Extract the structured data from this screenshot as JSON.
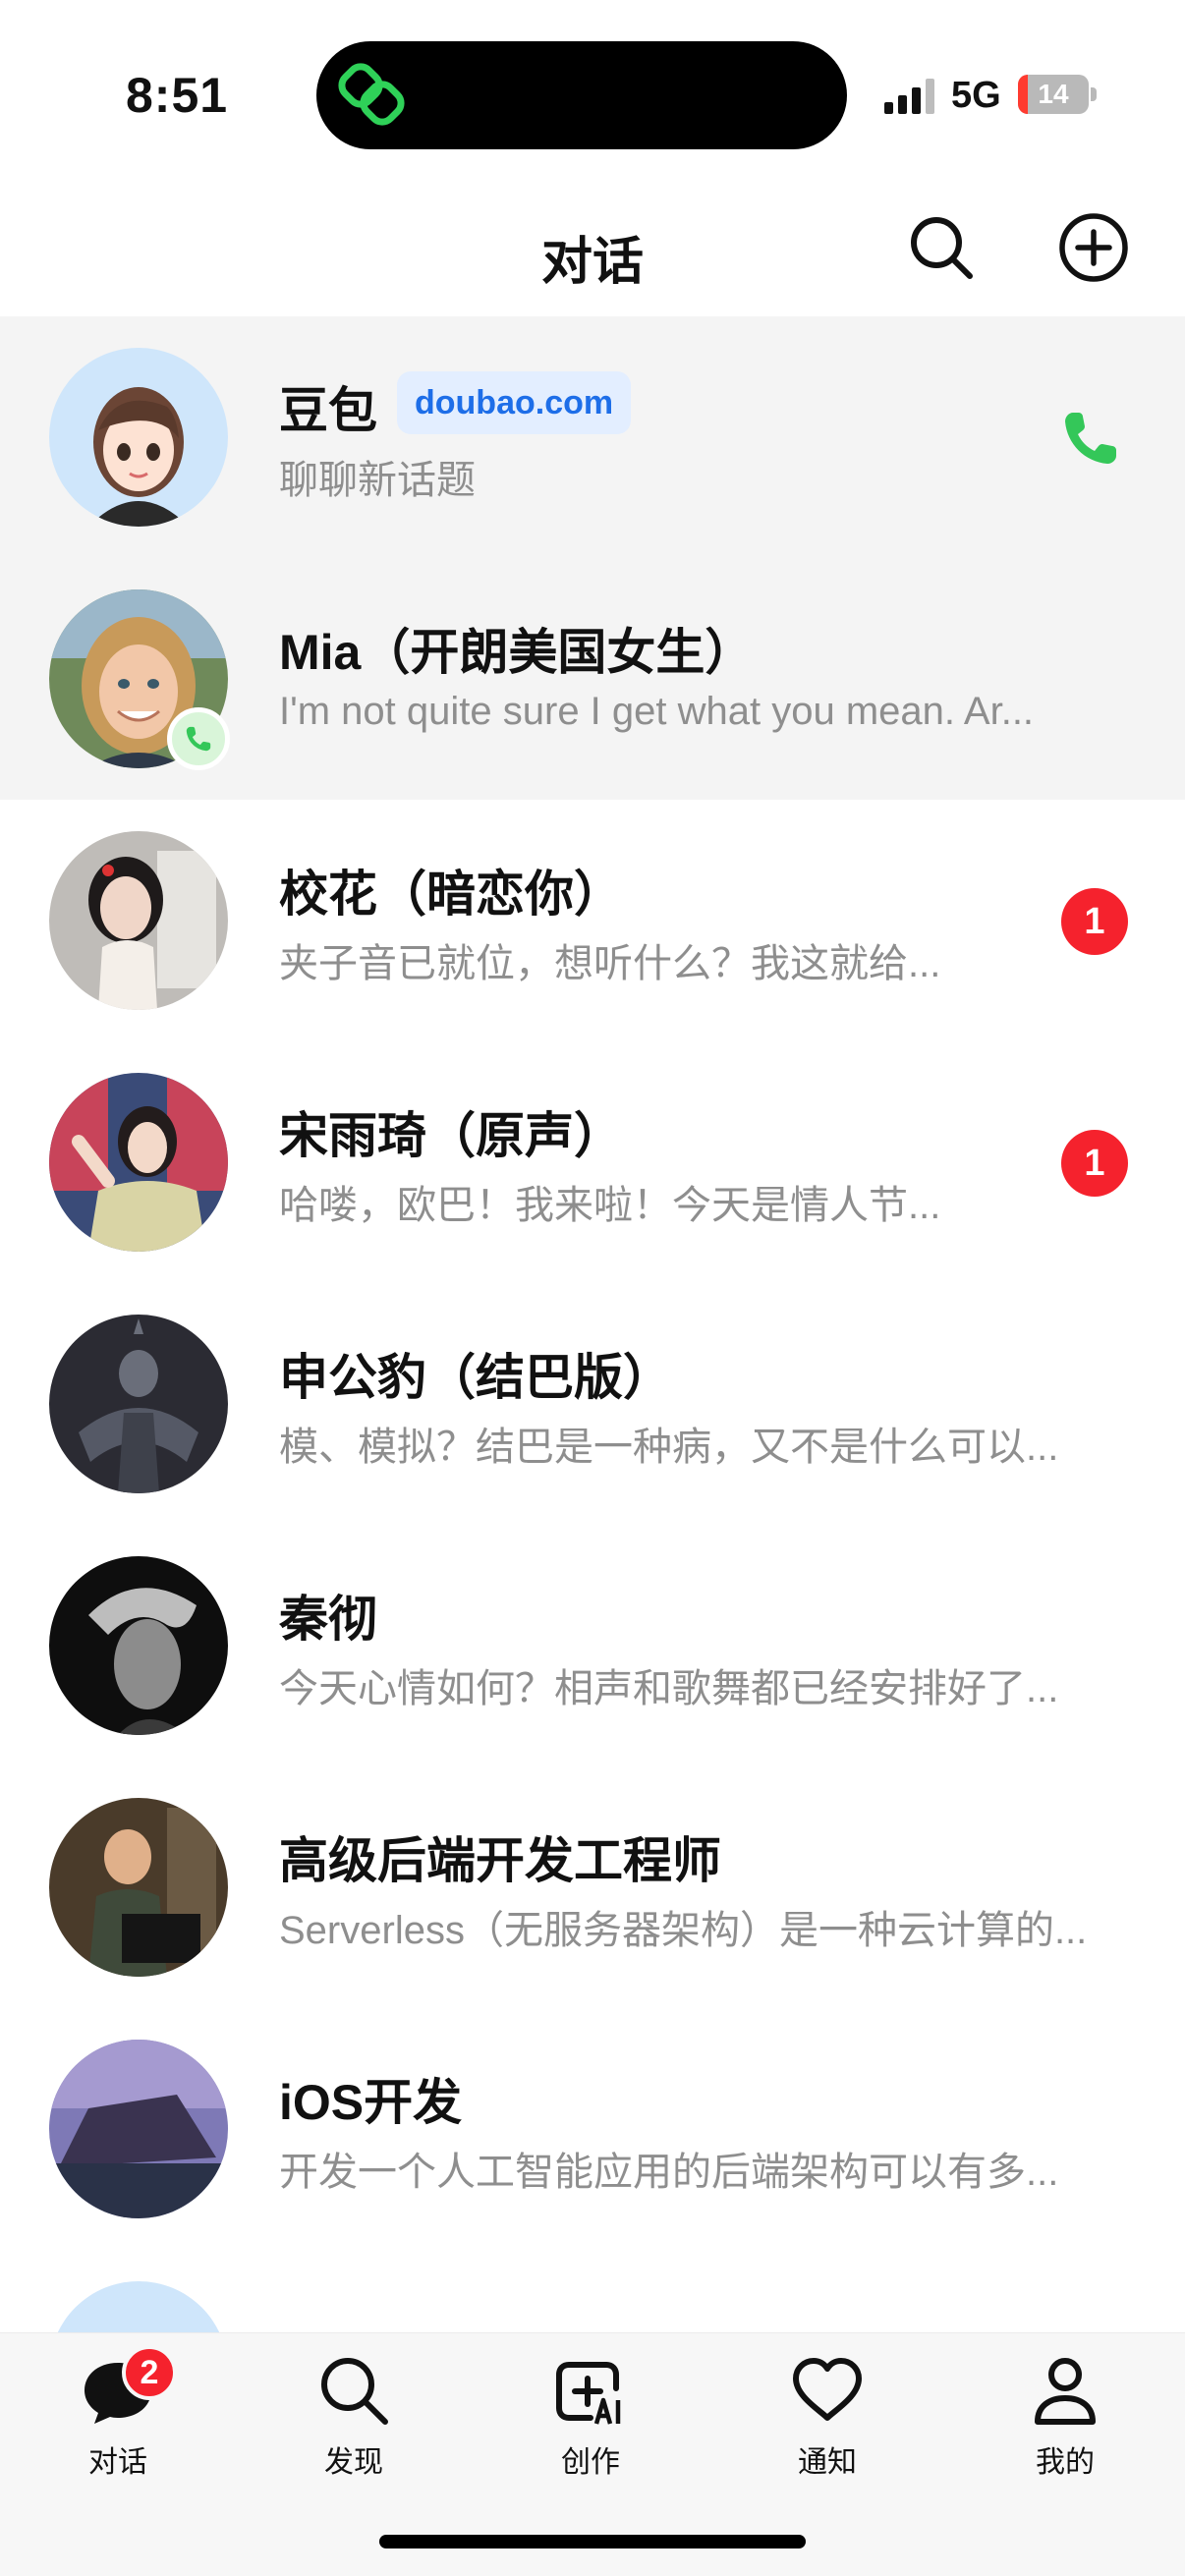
{
  "status_bar": {
    "time": "8:51",
    "network": "5G",
    "battery": "14",
    "battery_level": 0.14
  },
  "header": {
    "title": "对话"
  },
  "conversations": [
    {
      "name": "豆包",
      "tag": "doubao.com",
      "preview": "聊聊新话题",
      "pinned": true,
      "action_icon": "phone-icon"
    },
    {
      "name": "Mia（开朗美国女生）",
      "preview": "I'm not quite sure I get what you mean. Ar...",
      "pinned": true,
      "avatar_badge": "phone-icon"
    },
    {
      "name": "校花（暗恋你）",
      "preview": "夹子音已就位，想听什么？我这就给...",
      "unread": "1"
    },
    {
      "name": "宋雨琦（原声）",
      "preview": "哈喽，欧巴！我来啦！今天是情人节...",
      "unread": "1"
    },
    {
      "name": "申公豹（结巴版）",
      "preview": "模、模拟？结巴是一种病，又不是什么可以..."
    },
    {
      "name": "秦彻",
      "preview": "今天心情如何？相声和歌舞都已经安排好了..."
    },
    {
      "name": "高级后端开发工程师",
      "preview": "Serverless（无服务器架构）是一种云计算的..."
    },
    {
      "name": "iOS开发",
      "preview": "开发一个人工智能应用的后端架构可以有多..."
    },
    {
      "name": "",
      "preview": ""
    }
  ],
  "tabbar": {
    "tabs": [
      {
        "label": "对话",
        "icon": "chat-bubble-icon",
        "badge": "2",
        "active": true
      },
      {
        "label": "发现",
        "icon": "search-icon"
      },
      {
        "label": "创作",
        "icon": "create-ai-icon"
      },
      {
        "label": "通知",
        "icon": "heart-icon"
      },
      {
        "label": "我的",
        "icon": "person-icon"
      }
    ]
  },
  "colors": {
    "accent_green": "#34c759",
    "badge_red": "#f5222d",
    "tag_blue": "#1e6ee8",
    "pinned_bg": "#f4f4f4"
  }
}
